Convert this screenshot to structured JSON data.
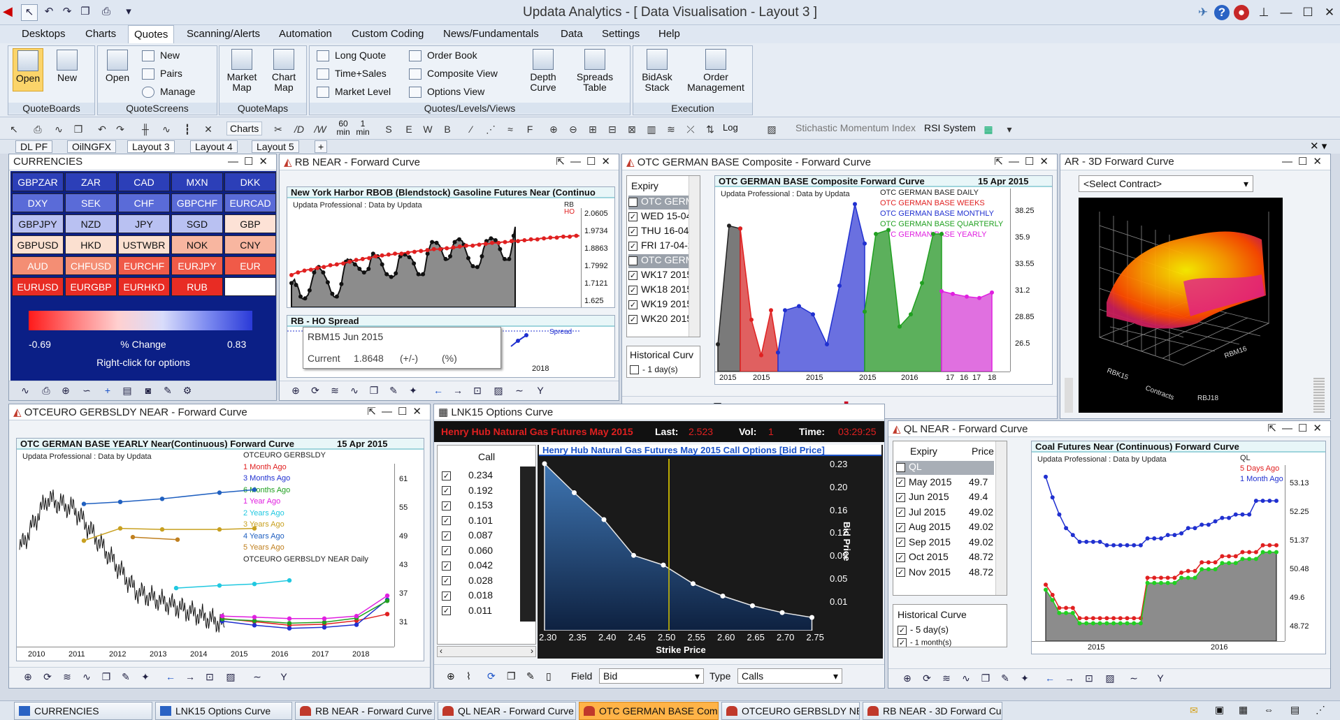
{
  "app": {
    "title": "Updata Analytics - [ Data Visualisation - Layout 3 ]"
  },
  "menu": [
    "Desktops",
    "Charts",
    "Quotes",
    "Scanning/Alerts",
    "Automation",
    "Custom Coding",
    "News/Fundamentals",
    "Data",
    "Settings",
    "Help"
  ],
  "ribbon": {
    "quoteboards": {
      "label": "QuoteBoards",
      "open": "Open",
      "new": "New"
    },
    "quotescreens": {
      "label": "QuoteScreens",
      "open": "Open",
      "new": "New",
      "pairs": "Pairs",
      "manage": "Manage"
    },
    "quotemaps": {
      "label": "QuoteMaps",
      "market": "Market Map",
      "chart": "Chart Map"
    },
    "levels": {
      "label": "Quotes/Levels/Views",
      "long": "Long Quote",
      "ts": "Time+Sales",
      "ml": "Market Level",
      "ob": "Order Book",
      "cv": "Composite View",
      "ov": "Options View",
      "depth": "Depth Curve",
      "spreads": "Spreads Table"
    },
    "execution": {
      "label": "Execution",
      "bidask": "BidAsk Stack",
      "order": "Order Management"
    }
  },
  "toolbar": {
    "charts": "Charts",
    "min60": "60 min",
    "min1": "1 min",
    "log": "Log",
    "smi": "Stichastic Momentum Index",
    "rsi": "RSI System"
  },
  "layout_tabs": [
    "DL PF",
    "OilNGFX",
    "Layout 3",
    "Layout 4",
    "Layout 5"
  ],
  "currencies": {
    "title": "CURRENCIES",
    "grid": [
      [
        "GBPZAR",
        "ZAR",
        "CAD",
        "MXN",
        "DKK"
      ],
      [
        "DXY",
        "SEK",
        "CHF",
        "GBPCHF",
        "EURCAD"
      ],
      [
        "GBPJPY",
        "NZD",
        "JPY",
        "SGD",
        "GBP"
      ],
      [
        "GBPUSD",
        "HKD",
        "USTWBR",
        "NOK",
        "CNY"
      ],
      [
        "AUD",
        "CHFUSD",
        "EURCHF",
        "EURJPY",
        "EUR"
      ],
      [
        "EURUSD",
        "EURGBP",
        "EURHKD",
        "RUB",
        ""
      ]
    ],
    "min": "-0.69",
    "max": "0.83",
    "legend": "% Change",
    "hint": "Right-click for options"
  },
  "rb": {
    "title": "RB NEAR - Forward Curve",
    "chart": "New York Harbor RBOB (Blendstock) Gasoline Futures Near (Continuo",
    "sub": "Updata Professional : Data by Updata",
    "legend": [
      "RB",
      "HO"
    ],
    "yticks": [
      "2.0605",
      "1.9734",
      "1.8863",
      "1.7992",
      "1.7121",
      "1.625"
    ],
    "spread_title": "RB - HO Spread",
    "spread_label": "Spread",
    "tooltip": {
      "name": "RBM15 Jun 2015",
      "label": "Current",
      "value": "1.8648",
      "chg": "(+/-)",
      "pct": "(%)"
    },
    "year": "2018"
  },
  "otc": {
    "title": "OTC GERMAN BASE Composite - Forward Curve",
    "expiry_label": "Expiry",
    "expiry": [
      "OTC GERM",
      "WED 15-04",
      "THU 16-04",
      "FRI 17-04-2",
      "OTC GERM",
      "WK17 2015",
      "WK18 2015",
      "WK19 2015",
      "WK20 2015"
    ],
    "hist_label": "Historical Curv",
    "hist_item": "- 1 day(s)",
    "chart": "OTC GERMAN BASE Composite  Forward Curve",
    "date": "15 Apr 2015",
    "sub": "Updata Professional : Data by Updata",
    "legend": [
      {
        "t": "OTC GERMAN BASE DAILY",
        "c": "#222222"
      },
      {
        "t": "OTC GERMAN BASE WEEKS",
        "c": "#e02020"
      },
      {
        "t": "OTC GERMAN BASE MONTHLY",
        "c": "#2030d0"
      },
      {
        "t": "OTC GERMAN BASE QUARTERLY",
        "c": "#20a020"
      },
      {
        "t": "OTC GERMAN BASE YEARLY",
        "c": "#e020e0"
      }
    ],
    "yticks": [
      "38.25",
      "35.9",
      "33.55",
      "31.2",
      "28.85",
      "26.5"
    ],
    "xticks": [
      "2015",
      "2015",
      "2015",
      "2015",
      "2016",
      "17",
      "16",
      "17",
      "18"
    ]
  },
  "threed": {
    "title": "AR - 3D Forward Curve",
    "select": "<Select Contract>",
    "axis": [
      "Contracts",
      "RBJ18",
      "RBM16"
    ]
  },
  "otceuro": {
    "title": "OTCEURO GERBSLDY NEAR - Forward Curve",
    "chart": "OTC GERMAN BASE YEARLY Near(Continuous)  Forward Curve",
    "date": "15 Apr 2015",
    "sub": "Updata Professional : Data by Updata",
    "legend": [
      {
        "t": "OTCEURO GERBSLDY",
        "c": "#222222"
      },
      {
        "t": "1 Month Ago",
        "c": "#e02020"
      },
      {
        "t": "3 Months Ago",
        "c": "#2030d0"
      },
      {
        "t": "6 Months Ago",
        "c": "#20a020"
      },
      {
        "t": "1 Year Ago",
        "c": "#e020e0"
      },
      {
        "t": "2 Years Ago",
        "c": "#20c8e0"
      },
      {
        "t": "3 Years Ago",
        "c": "#c8a020"
      },
      {
        "t": "4 Years Ago",
        "c": "#2060c0"
      },
      {
        "t": "5 Years Ago",
        "c": "#c08020"
      },
      {
        "t": "OTCEURO GERBSLDY NEAR Daily",
        "c": "#222222"
      }
    ],
    "yticks": [
      "61",
      "55",
      "49",
      "43",
      "37",
      "31"
    ],
    "xticks": [
      "2010",
      "2011",
      "2012",
      "2013",
      "2014",
      "2015",
      "2016",
      "2017",
      "2018"
    ]
  },
  "lnk": {
    "title": "LNK15 Options Curve",
    "banner_name": "Henry Hub Natural Gas Futures May 2015",
    "last_label": "Last:",
    "last": "2.523",
    "vol_label": "Vol:",
    "vol": "1",
    "time_label": "Time:",
    "time": "03:29:25",
    "col": "Call",
    "calls": [
      "0.234",
      "0.192",
      "0.153",
      "0.101",
      "0.087",
      "0.060",
      "0.042",
      "0.028",
      "0.018",
      "0.011"
    ],
    "chart": "Henry Hub Natural Gas Futures May 2015 Call Options [Bid Price]",
    "yticks": [
      "0.23",
      "0.20",
      "0.16",
      "0.12",
      "0.09",
      "0.05",
      "0.01"
    ],
    "xticks": [
      "2.30",
      "2.35",
      "2.40",
      "2.45",
      "2.50",
      "2.55",
      "2.60",
      "2.65",
      "2.70",
      "2.75"
    ],
    "xlabel": "Strike Price",
    "ylabel": "Bid Price",
    "field_label": "Field",
    "field": "Bid",
    "type_label": "Type",
    "type": "Calls"
  },
  "ql": {
    "title": "QL NEAR - Forward Curve",
    "expiry_label": "Expiry",
    "price_label": "Price",
    "rows": [
      {
        "e": "QL",
        "p": ""
      },
      {
        "e": "May 2015",
        "p": "49.7"
      },
      {
        "e": "Jun 2015",
        "p": "49.4"
      },
      {
        "e": "Jul 2015",
        "p": "49.02"
      },
      {
        "e": "Aug 2015",
        "p": "49.02"
      },
      {
        "e": "Sep 2015",
        "p": "49.02"
      },
      {
        "e": "Oct 2015",
        "p": "48.72"
      },
      {
        "e": "Nov 2015",
        "p": "48.72"
      }
    ],
    "hist_label": "Historical Curve",
    "hist": [
      "- 5 day(s)",
      "- 1 month(s)"
    ],
    "chart": "Coal Futures Near (Continuous)  Forward Curve",
    "sub": "Updata Professional : Data by Updata",
    "legend": [
      {
        "t": "QL",
        "c": "#222222"
      },
      {
        "t": "5 Days Ago",
        "c": "#e02020"
      },
      {
        "t": "1 Month Ago",
        "c": "#2030d0"
      }
    ],
    "yticks": [
      "53.13",
      "52.25",
      "51.37",
      "50.48",
      "49.6",
      "48.72"
    ],
    "xticks": [
      "2015",
      "2016"
    ]
  },
  "taskbar": [
    "CURRENCIES",
    "LNK15 Options Curve",
    "RB NEAR - Forward Curve",
    "QL NEAR - Forward Curve",
    "OTC GERMAN BASE Comp",
    "OTCEURO GERBSLDY NE",
    "RB NEAR - 3D Forward Cur"
  ],
  "colors": {
    "accent": "#2b4fd6",
    "red": "#e02020",
    "blue": "#2030d0",
    "green": "#20a020",
    "magenta": "#e020e0"
  }
}
